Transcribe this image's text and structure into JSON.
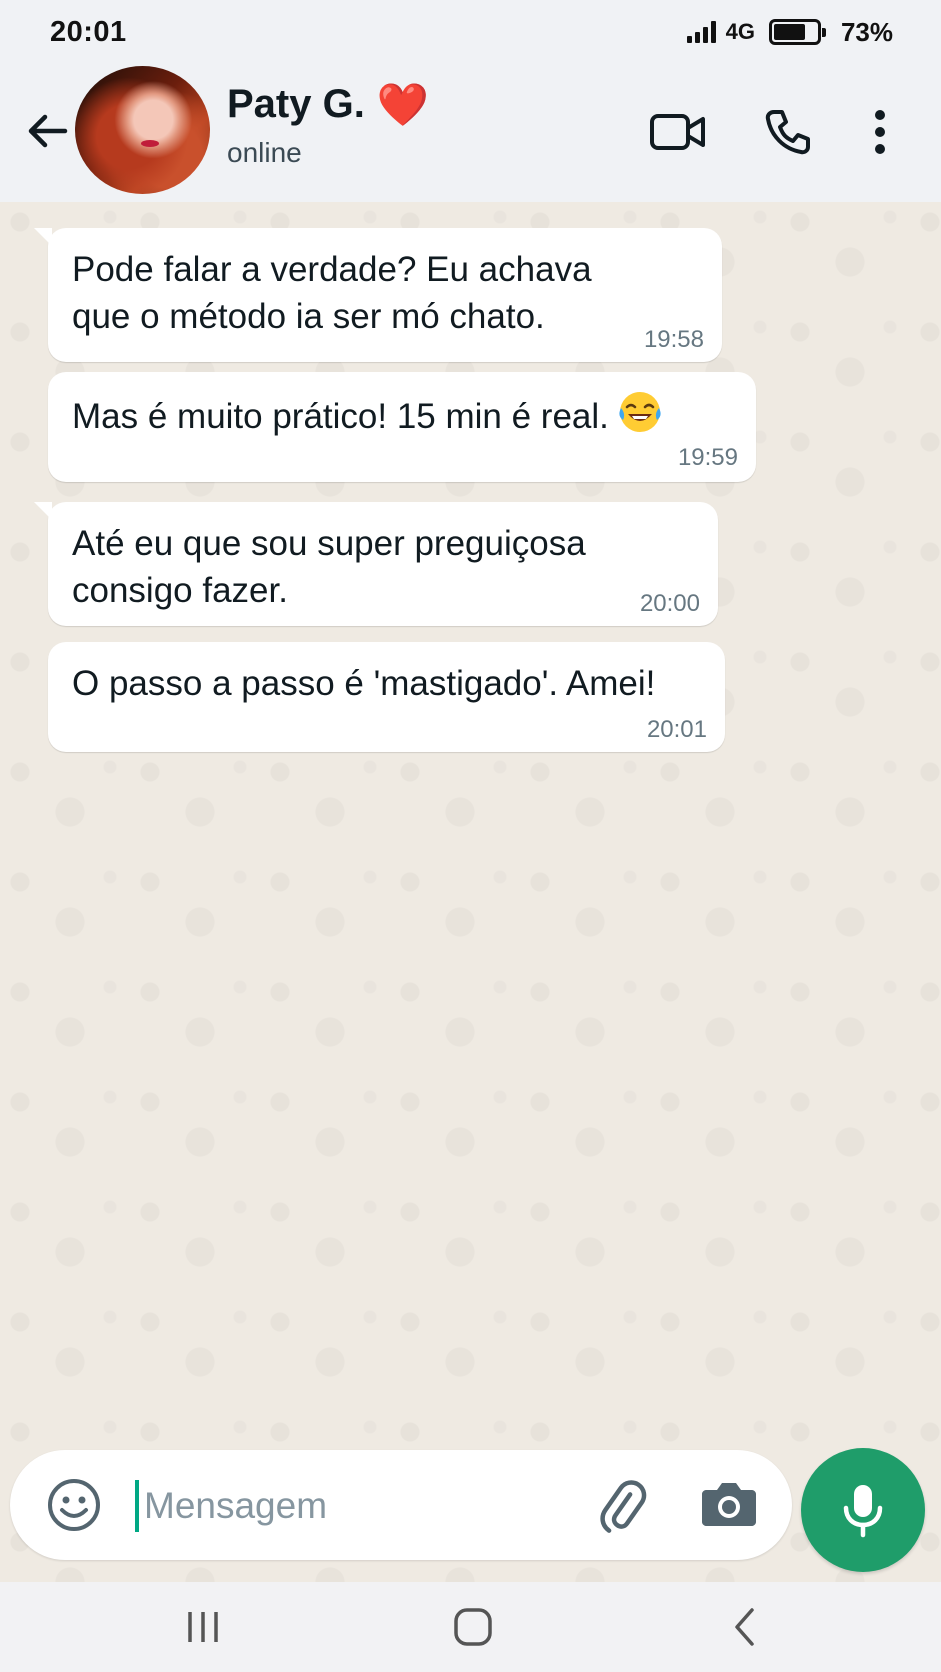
{
  "status_bar": {
    "time": "20:01",
    "network": "4G",
    "battery_percent": "73%",
    "battery_level": 0.73
  },
  "header": {
    "contact_name": "Paty G.",
    "contact_emoji": "❤️",
    "contact_status": "online",
    "icons": [
      "back-arrow-icon",
      "video-call-icon",
      "phone-icon",
      "more-options-icon"
    ]
  },
  "messages": [
    {
      "line1": "Pode falar a verdade? Eu achava",
      "line2": "que o método ia ser mó chato.",
      "time": "19:58"
    },
    {
      "line1": "Mas é muito prático! 15 min é real.",
      "emoji": "😂",
      "time": "19:59"
    },
    {
      "line1": "Até eu que sou super preguiçosa",
      "line2": "consigo fazer.",
      "time": "20:00"
    },
    {
      "line1": "O passo a passo é 'mastigado'. Amei!",
      "time": "20:01"
    }
  ],
  "composer": {
    "placeholder": "Mensagem",
    "icons": [
      "emoji-icon",
      "attach-icon",
      "camera-icon",
      "microphone-icon"
    ]
  },
  "colors": {
    "accent": "#1f9d6a",
    "chat_background": "#efeae2",
    "bubble": "#ffffff",
    "header": "#f0f2f5"
  }
}
